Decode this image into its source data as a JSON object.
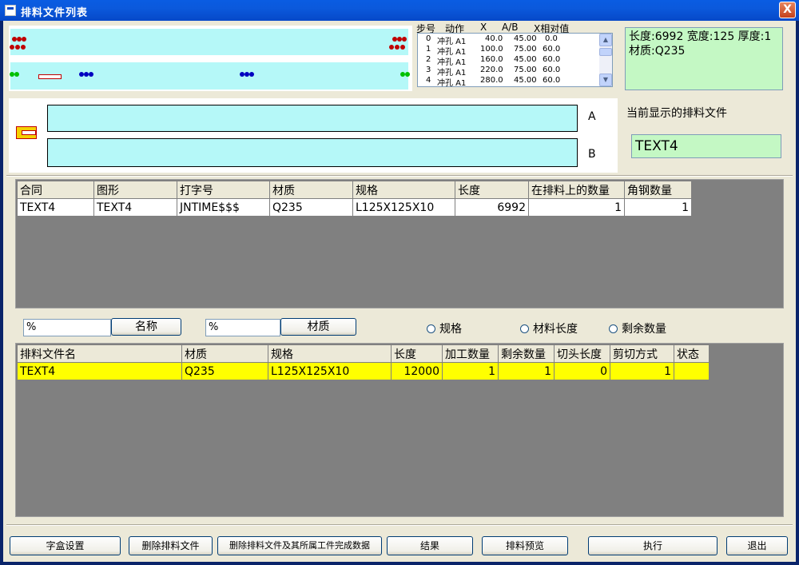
{
  "window": {
    "title": "排料文件列表",
    "close_glyph": "X"
  },
  "steps_list": {
    "headers": {
      "step": "步号",
      "action": "动作",
      "x": "X",
      "ab": "A/B",
      "rel": "X相对值"
    },
    "rows": [
      {
        "step": "0",
        "action": "冲孔 A1",
        "x": "40.0",
        "ab": "45.00",
        "rel": "0.0"
      },
      {
        "step": "1",
        "action": "冲孔 A1",
        "x": "100.0",
        "ab": "75.00",
        "rel": "60.0"
      },
      {
        "step": "2",
        "action": "冲孔 A1",
        "x": "160.0",
        "ab": "45.00",
        "rel": "60.0"
      },
      {
        "step": "3",
        "action": "冲孔 A1",
        "x": "220.0",
        "ab": "75.00",
        "rel": "60.0"
      },
      {
        "step": "4",
        "action": "冲孔 A1",
        "x": "280.0",
        "ab": "45.00",
        "rel": "60.0"
      }
    ]
  },
  "info": {
    "line1": "长度:6992 宽度:125 厚度:1",
    "line2": "材质:Q235"
  },
  "preview": {
    "label_a": "A",
    "label_b": "B"
  },
  "current_file": {
    "label": "当前显示的排料文件",
    "value": "TEXT4"
  },
  "top_table": {
    "headers": [
      "合同",
      "图形",
      "打字号",
      "材质",
      "规格",
      "长度",
      "在排料上的数量",
      "角钢数量"
    ],
    "rows": [
      [
        "TEXT4",
        "TEXT4",
        "JNTIME$$$",
        "Q235",
        "L125X125X10",
        "6992",
        "1",
        "1"
      ]
    ]
  },
  "filter": {
    "name_value": "%",
    "name_button": "名称",
    "material_value": "%",
    "material_button": "材质",
    "radio_spec": "规格",
    "radio_length": "材料长度",
    "radio_remaining": "剩余数量"
  },
  "bottom_table": {
    "headers": [
      "排料文件名",
      "材质",
      "规格",
      "长度",
      "加工数量",
      "剩余数量",
      "切头长度",
      "剪切方式",
      "状态"
    ],
    "rows": [
      [
        "TEXT4",
        "Q235",
        "L125X125X10",
        "12000",
        "1",
        "1",
        "0",
        "1",
        ""
      ]
    ]
  },
  "buttons": {
    "font_box": "字盒设置",
    "delete_file": "删除排料文件",
    "delete_file_and_data": "删除排料文件及其所属工件完成数据",
    "result": "结果",
    "preview": "排料预览",
    "execute": "执行",
    "exit": "退出"
  },
  "colors": {
    "cyan": "#b5f8f8",
    "info_green": "#c4f8c4",
    "selected_row": "#ffff00",
    "grid_bg": "#808080"
  }
}
